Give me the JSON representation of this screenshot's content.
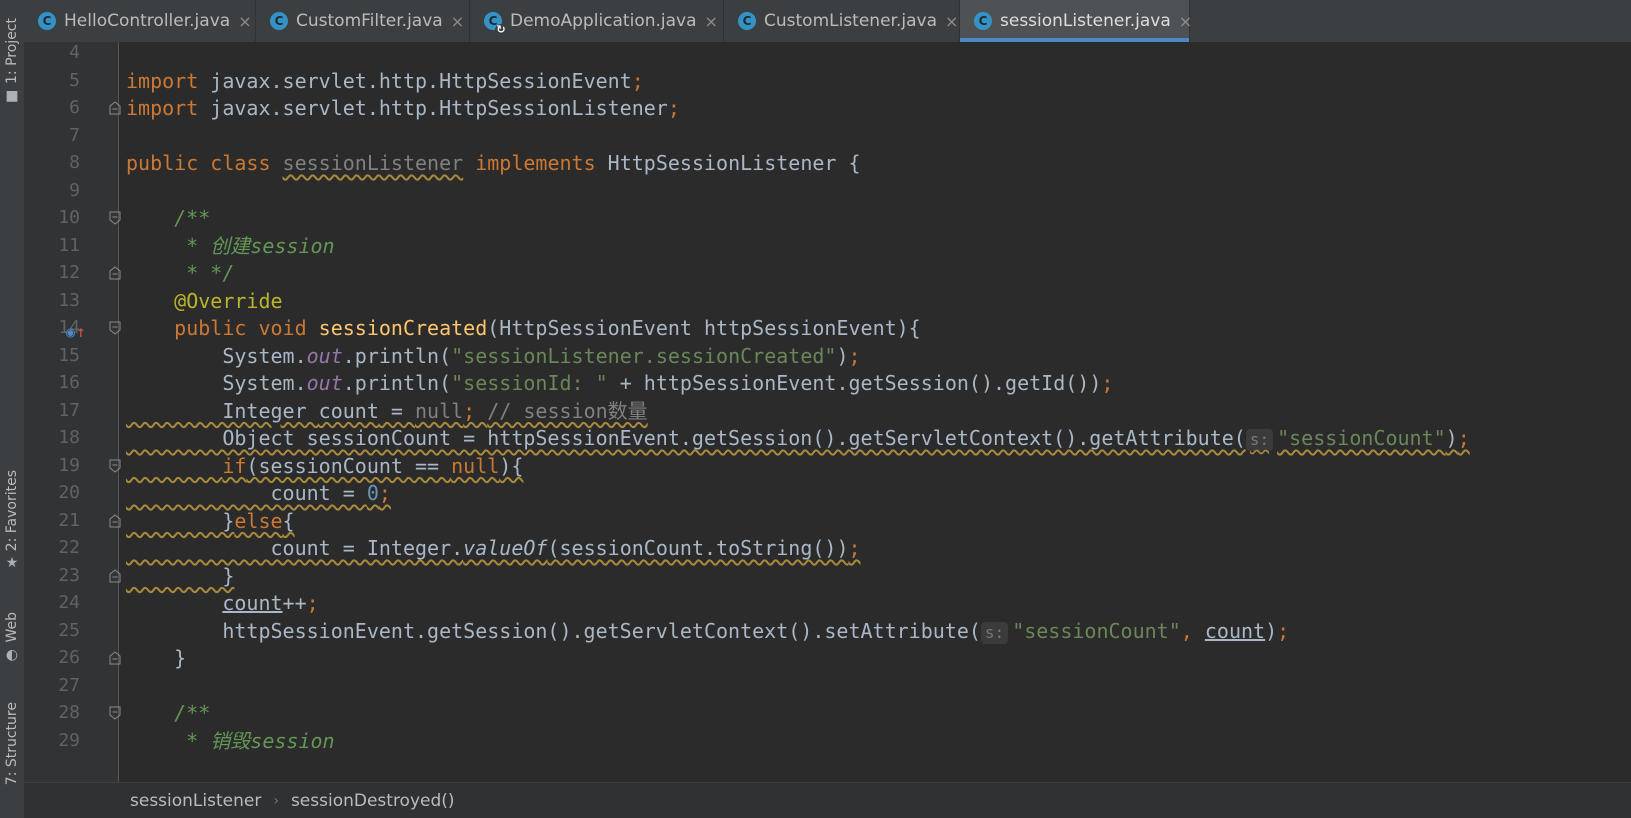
{
  "tool_windows": [
    {
      "label": "1: Project",
      "icon": "folder-icon"
    },
    {
      "label": "2: Favorites",
      "icon": "star-icon"
    },
    {
      "label": "Web",
      "icon": "globe-icon"
    },
    {
      "label": "7: Structure",
      "icon": "structure-icon"
    }
  ],
  "tabs": [
    {
      "label": "HelloController.java",
      "icon": "C",
      "active": false
    },
    {
      "label": "CustomFilter.java",
      "icon": "C",
      "active": false
    },
    {
      "label": "DemoApplication.java",
      "icon": "C",
      "active": false
    },
    {
      "label": "CustomListener.java",
      "icon": "C",
      "active": false
    },
    {
      "label": "sessionListener.java",
      "icon": "C",
      "active": true
    }
  ],
  "tab_close_glyph": "×",
  "code": {
    "lines": [
      {
        "n": "4",
        "tokens": []
      },
      {
        "n": "5",
        "tokens": [
          {
            "t": "import",
            "c": "kw"
          },
          {
            "t": " javax.servlet.http.HttpSessionEvent"
          },
          {
            "t": ";",
            "c": "kw"
          }
        ]
      },
      {
        "n": "6",
        "tokens": [
          {
            "t": "import",
            "c": "kw"
          },
          {
            "t": " javax.servlet.http.HttpSessionListener"
          },
          {
            "t": ";",
            "c": "kw"
          }
        ]
      },
      {
        "n": "7",
        "tokens": []
      },
      {
        "n": "8",
        "tokens": [
          {
            "t": "public class",
            "c": "kw"
          },
          {
            "t": " "
          },
          {
            "t": "sessionListener",
            "c": "gray warn"
          },
          {
            "t": " "
          },
          {
            "t": "implements",
            "c": "kw"
          },
          {
            "t": " HttpSessionListener {"
          }
        ]
      },
      {
        "n": "9",
        "tokens": []
      },
      {
        "n": "10",
        "tokens": [
          {
            "t": "    /**",
            "c": "cmt"
          }
        ]
      },
      {
        "n": "11",
        "tokens": [
          {
            "t": "     * 创建session",
            "c": "cmt"
          }
        ]
      },
      {
        "n": "12",
        "tokens": [
          {
            "t": "     * */",
            "c": "cmt"
          }
        ]
      },
      {
        "n": "13",
        "tokens": [
          {
            "t": "    "
          },
          {
            "t": "@Override",
            "c": "ann"
          }
        ]
      },
      {
        "n": "14",
        "tokens": [
          {
            "t": "    "
          },
          {
            "t": "public void",
            "c": "kw"
          },
          {
            "t": " "
          },
          {
            "t": "sessionCreated",
            "c": "fn"
          },
          {
            "t": "(HttpSessionEvent httpSessionEvent){"
          }
        ]
      },
      {
        "n": "15",
        "tokens": [
          {
            "t": "        System."
          },
          {
            "t": "out",
            "c": "field"
          },
          {
            "t": ".println("
          },
          {
            "t": "\"sessionListener.sessionCreated\"",
            "c": "str"
          },
          {
            "t": ")"
          },
          {
            "t": ";",
            "c": "kw"
          }
        ]
      },
      {
        "n": "16",
        "tokens": [
          {
            "t": "        System."
          },
          {
            "t": "out",
            "c": "field"
          },
          {
            "t": ".println("
          },
          {
            "t": "\"sessionId: \"",
            "c": "str"
          },
          {
            "t": " + httpSessionEvent.getSession().getId())"
          },
          {
            "t": ";",
            "c": "kw"
          }
        ]
      },
      {
        "n": "17",
        "tokens": [
          {
            "t": "        Integer "
          },
          {
            "t": "count",
            "c": "ul"
          },
          {
            "t": " = "
          },
          {
            "t": "null",
            "c": "gray"
          },
          {
            "t": "; ",
            "c": "kw"
          },
          {
            "t": "// session数量",
            "c": "lcmt"
          }
        ]
      },
      {
        "n": "18",
        "tokens": [
          {
            "t": "        Object sessionCount = httpSessionEvent.getSession().getServletContext().getAttribute("
          },
          {
            "t": "s:",
            "c": "hint"
          },
          {
            "t": "\"sessionCount\"",
            "c": "str"
          },
          {
            "t": ")"
          },
          {
            "t": ";",
            "c": "kw"
          }
        ]
      },
      {
        "n": "19",
        "tokens": [
          {
            "t": "        "
          },
          {
            "t": "if",
            "c": "kw"
          },
          {
            "t": "(sessionCount == "
          },
          {
            "t": "null",
            "c": "kw"
          },
          {
            "t": "){"
          }
        ]
      },
      {
        "n": "20",
        "tokens": [
          {
            "t": "            count = "
          },
          {
            "t": "0",
            "c": "num"
          },
          {
            "t": ";",
            "c": "kw"
          }
        ]
      },
      {
        "n": "21",
        "tokens": [
          {
            "t": "        }"
          },
          {
            "t": "else",
            "c": "kw"
          },
          {
            "t": "{"
          }
        ]
      },
      {
        "n": "22",
        "tokens": [
          {
            "t": "            count = Integer."
          },
          {
            "t": "valueOf",
            "c": "static"
          },
          {
            "t": "(sessionCount.toString())"
          },
          {
            "t": ";",
            "c": "kw"
          }
        ]
      },
      {
        "n": "23",
        "tokens": [
          {
            "t": "        }"
          }
        ]
      },
      {
        "n": "24",
        "tokens": [
          {
            "t": "        "
          },
          {
            "t": "count",
            "c": "ul"
          },
          {
            "t": "++"
          },
          {
            "t": ";",
            "c": "kw"
          }
        ]
      },
      {
        "n": "25",
        "tokens": [
          {
            "t": "        httpSessionEvent.getSession().getServletContext().setAttribute("
          },
          {
            "t": "s:",
            "c": "hint"
          },
          {
            "t": "\"sessionCount\"",
            "c": "str"
          },
          {
            "t": ", ",
            "c": "kw"
          },
          {
            "t": "count",
            "c": "ul"
          },
          {
            "t": ")"
          },
          {
            "t": ";",
            "c": "kw"
          }
        ]
      },
      {
        "n": "26",
        "tokens": [
          {
            "t": "    }"
          }
        ]
      },
      {
        "n": "27",
        "tokens": []
      },
      {
        "n": "28",
        "tokens": [
          {
            "t": "    /**",
            "c": "cmt"
          }
        ]
      },
      {
        "n": "29",
        "tokens": [
          {
            "t": "     * 销毁session",
            "c": "cmt"
          }
        ]
      }
    ]
  },
  "breadcrumbs": [
    "sessionListener",
    "sessionDestroyed()"
  ],
  "breadcrumb_separator": "›",
  "colors": {
    "keyword": "#cc7832",
    "string": "#6a8759",
    "number": "#6897bb",
    "doc_comment": "#629755",
    "annotation": "#bbb529",
    "method": "#ffc66d",
    "field": "#9876aa",
    "active_tab_underline": "#4a88c7"
  }
}
